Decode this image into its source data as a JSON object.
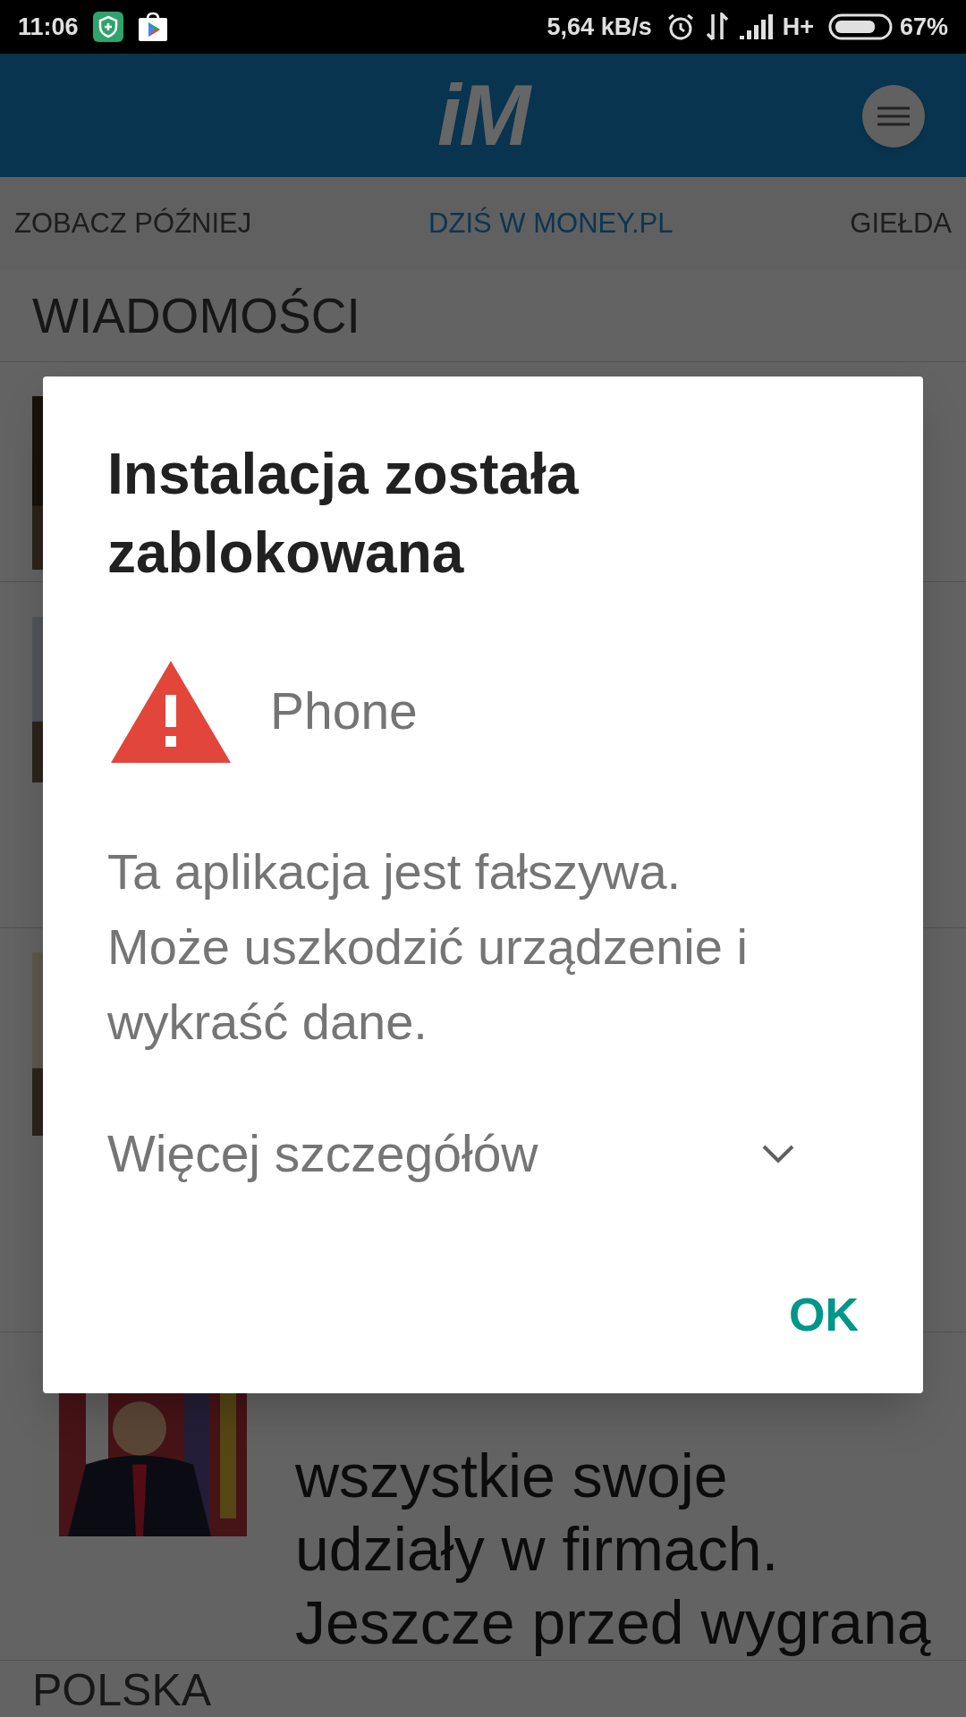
{
  "status_bar": {
    "time": "11:06",
    "network_speed": "5,64 kB/s",
    "network_type": "H+",
    "battery": "67%"
  },
  "header": {
    "logo": "iM"
  },
  "tabs": [
    {
      "label": "ZOBACZ PÓŹNIEJ",
      "selected": false
    },
    {
      "label": "DZIŚ W MONEY.PL",
      "selected": true
    },
    {
      "label": "GIEŁDA",
      "selected": false
    }
  ],
  "news": {
    "title": "WIADOMOŚCI",
    "articles": [
      {
        "kind": "picture"
      },
      {
        "kind": "picture"
      },
      {
        "kind": "picture"
      },
      {
        "kind": "picture",
        "title_lines": [
          "wszystkie swoje",
          "udziały w firmach.",
          "Jeszcze przed wygraną"
        ]
      }
    ]
  },
  "next_section": {
    "title": "POLSKA"
  },
  "dialog": {
    "title": "Instalacja została zablokowana",
    "app_name": "Phone",
    "message_lines": [
      "Ta aplikacja jest fałszywa.",
      "Może uszkodzić urządzenie i",
      "wykraść dane."
    ],
    "details": {
      "label": "Więcej szczegółów",
      "expanded": false
    },
    "button": "OK"
  }
}
